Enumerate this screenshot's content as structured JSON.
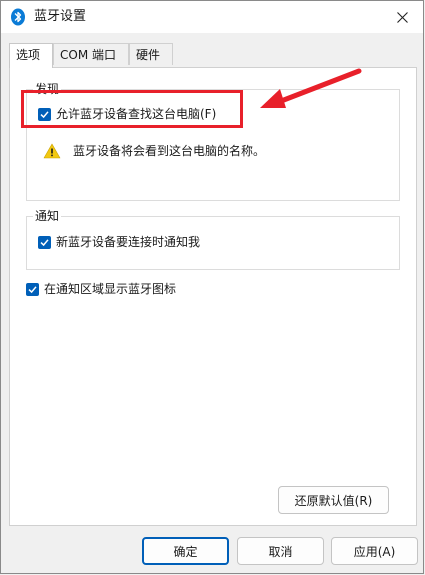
{
  "window": {
    "title": "蓝牙设置"
  },
  "tabs": [
    {
      "label": "选项",
      "active": true
    },
    {
      "label": "COM 端口",
      "active": false
    },
    {
      "label": "硬件",
      "active": false
    }
  ],
  "discovery": {
    "legend": "发现",
    "allow_find_label": "允许蓝牙设备查找这台电脑(F)",
    "allow_find_checked": true,
    "warning_text": "蓝牙设备将会看到这台电脑的名称。"
  },
  "notifications": {
    "legend": "通知",
    "notify_label": "新蓝牙设备要连接时通知我",
    "notify_checked": true
  },
  "show_tray_icon": {
    "label": "在通知区域显示蓝牙图标",
    "checked": true
  },
  "buttons": {
    "restore_defaults": "还原默认值(R)",
    "ok": "确定",
    "cancel": "取消",
    "apply": "应用(A)"
  },
  "colors": {
    "accent": "#005fb8",
    "annotation": "#e8202a",
    "warning": "#f2c811"
  },
  "icons": {
    "title": "bluetooth-icon",
    "close": "close-icon",
    "checkbox": "checkmark-icon",
    "warning": "warning-icon",
    "annotation": "red-arrow-annotation"
  }
}
